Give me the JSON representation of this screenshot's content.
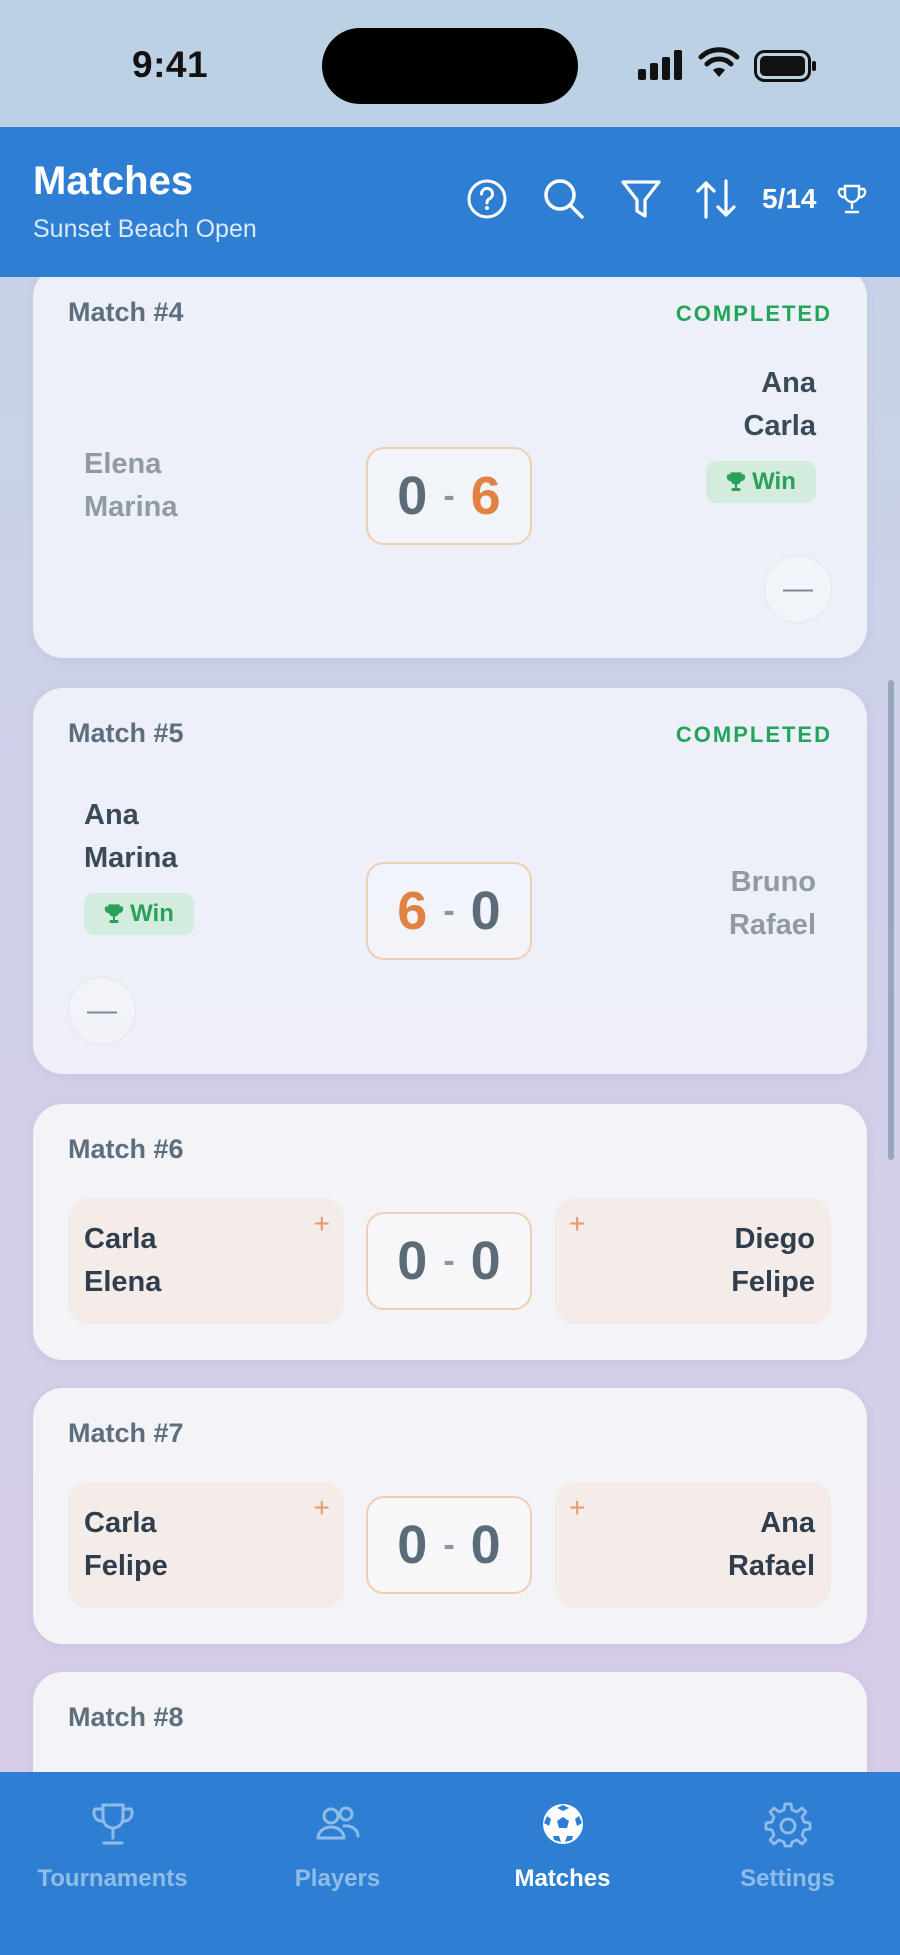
{
  "status_bar": {
    "time": "9:41"
  },
  "header": {
    "title": "Matches",
    "subtitle": "Sunset Beach Open",
    "match_count": "5/14",
    "colors": {
      "primary": "#2e7fd4"
    },
    "icons": [
      "help-icon",
      "search-icon",
      "filter-icon",
      "sort-icon",
      "trophy-icon"
    ]
  },
  "matches": [
    {
      "label": "Match #4",
      "status": "COMPLETED",
      "team_a": {
        "p1": "Elena",
        "p2": "Marina"
      },
      "team_b": {
        "p1": "Ana",
        "p2": "Carla"
      },
      "score_a": "0",
      "score_b": "6",
      "winner_badge": "Win",
      "adjust_symbol": "—"
    },
    {
      "label": "Match #5",
      "status": "COMPLETED",
      "team_a": {
        "p1": "Ana",
        "p2": "Marina"
      },
      "team_b": {
        "p1": "Bruno",
        "p2": "Rafael"
      },
      "score_a": "6",
      "score_b": "0",
      "winner_badge": "Win",
      "adjust_symbol": "—"
    },
    {
      "label": "Match #6",
      "team_a": {
        "p1": "Carla",
        "p2": "Elena"
      },
      "team_b": {
        "p1": "Diego",
        "p2": "Felipe"
      },
      "score_a": "0",
      "score_b": "0",
      "plus_symbol": "+"
    },
    {
      "label": "Match #7",
      "team_a": {
        "p1": "Carla",
        "p2": "Felipe"
      },
      "team_b": {
        "p1": "Ana",
        "p2": "Rafael"
      },
      "score_a": "0",
      "score_b": "0",
      "plus_symbol": "+"
    },
    {
      "label": "Match #8"
    }
  ],
  "score_separator": "-",
  "colors": {
    "completed": "#22a45a",
    "accent_orange": "#e08243",
    "win_bg": "#d3ecdd"
  },
  "tab_bar": {
    "tabs": [
      {
        "label": "Tournaments",
        "icon": "trophy-icon"
      },
      {
        "label": "Players",
        "icon": "users-icon"
      },
      {
        "label": "Matches",
        "icon": "soccer-ball-icon",
        "active": true
      },
      {
        "label": "Settings",
        "icon": "gear-icon"
      }
    ]
  }
}
